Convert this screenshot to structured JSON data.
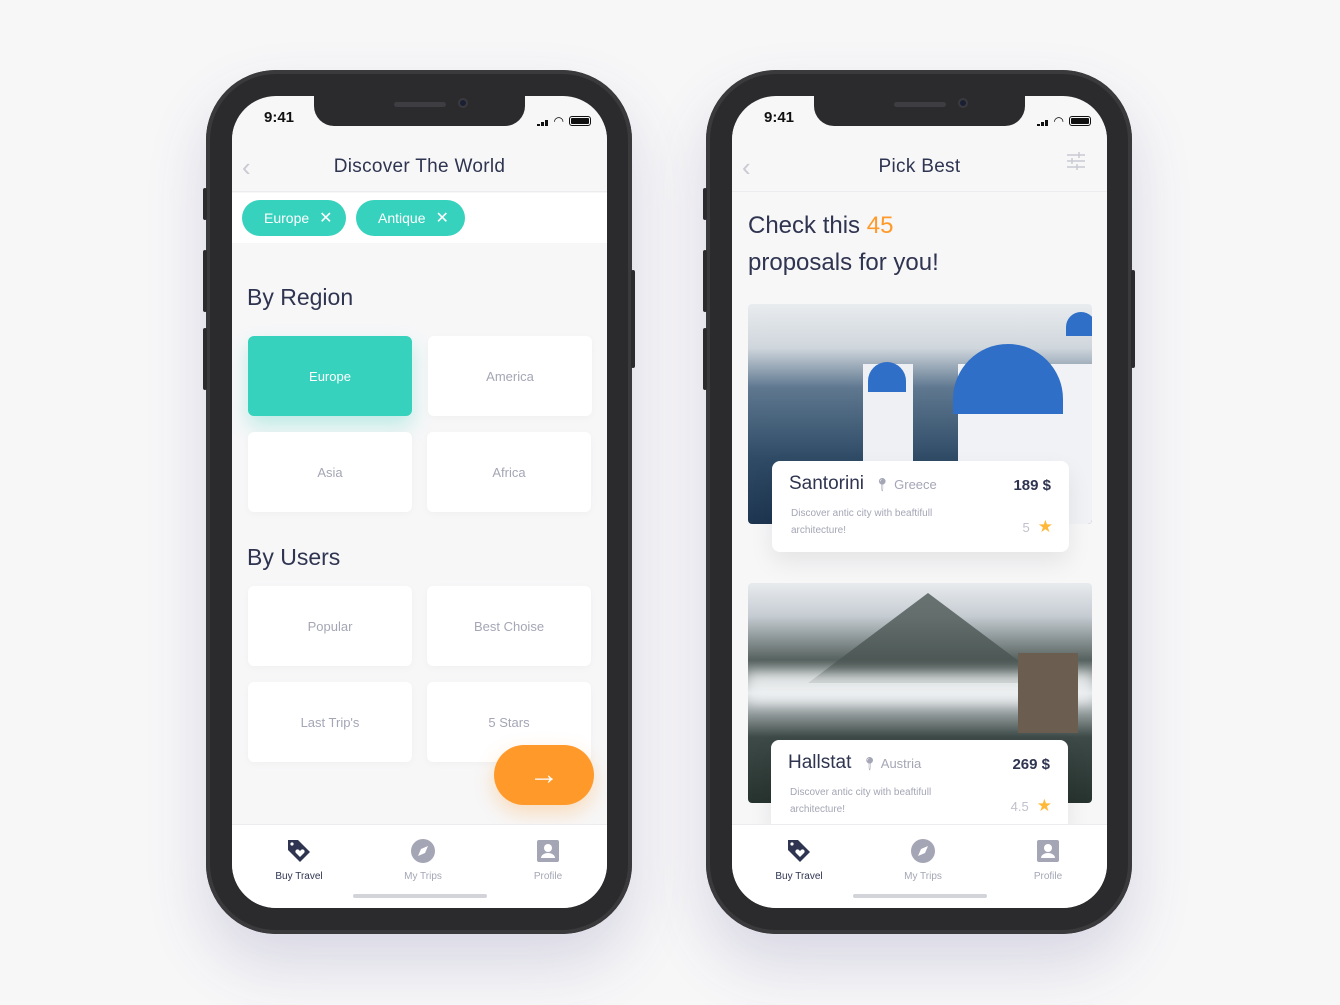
{
  "status": {
    "time": "9:41"
  },
  "left": {
    "title": "Discover The World",
    "chips": [
      {
        "label": "Europe"
      },
      {
        "label": "Antique"
      }
    ],
    "region_heading": "By Region",
    "regions": [
      {
        "label": "Europe",
        "selected": true
      },
      {
        "label": "America"
      },
      {
        "label": "Asia"
      },
      {
        "label": "Africa"
      }
    ],
    "users_heading": "By Users",
    "users": [
      {
        "label": "Popular"
      },
      {
        "label": "Best Choise"
      },
      {
        "label": "Last Trip's"
      },
      {
        "label": "5 Stars"
      }
    ],
    "next_icon": "arrow-right-icon"
  },
  "right": {
    "title": "Pick Best",
    "headline_prefix": "Check this ",
    "count": "45",
    "headline_suffix": "proposals for you!",
    "cards": [
      {
        "name": "Santorini",
        "location": "Greece",
        "price": "189 $",
        "description": "Discover antic city with beaftifull architecture!",
        "rating": "5"
      },
      {
        "name": "Hallstat",
        "location": "Austria",
        "price": "269 $",
        "description": "Discover antic city with beaftifull architecture!",
        "rating": "4.5"
      }
    ]
  },
  "tabs": [
    {
      "label": "Buy Travel",
      "icon": "tag-heart-icon",
      "active": true
    },
    {
      "label": "My Trips",
      "icon": "compass-icon"
    },
    {
      "label": "Profile",
      "icon": "profile-icon"
    }
  ],
  "colors": {
    "accent": "#37d2bd",
    "orange": "#ff9a2a",
    "text": "#2f3450",
    "muted": "#a4a6b5",
    "star": "#ffb838"
  }
}
